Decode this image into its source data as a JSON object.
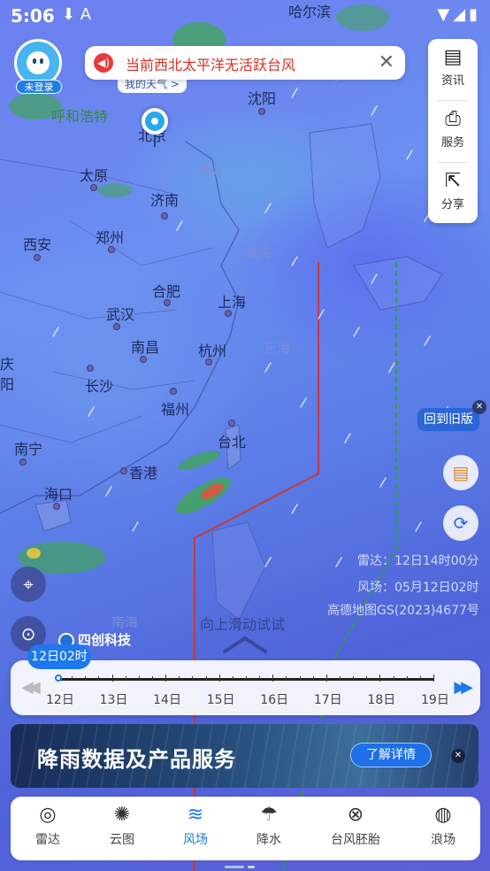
{
  "status_bar": {
    "time": "5:06",
    "left_icons": "⬇ A",
    "right_icons": "▼◢▮"
  },
  "user": {
    "login_badge": "未登录"
  },
  "notice": {
    "text": "当前西北太平洋无活跃台风"
  },
  "location": {
    "weather_tag": "我的天气 >"
  },
  "side_menu": [
    {
      "label": "资讯",
      "icon": "news-icon",
      "glyph": "▤"
    },
    {
      "label": "服务",
      "icon": "service-icon",
      "glyph": "⎙"
    },
    {
      "label": "分享",
      "icon": "share-icon",
      "glyph": "⇱"
    }
  ],
  "map": {
    "cities": [
      {
        "name": "哈尔滨",
        "class": ""
      },
      {
        "name": "呼和浩特",
        "class": "green"
      },
      {
        "name": "北京",
        "class": ""
      },
      {
        "name": "沈阳",
        "class": ""
      },
      {
        "name": "太原",
        "class": ""
      },
      {
        "name": "济南",
        "class": ""
      },
      {
        "name": "渤海",
        "class": "sea"
      },
      {
        "name": "西安",
        "class": ""
      },
      {
        "name": "郑州",
        "class": ""
      },
      {
        "name": "黄海",
        "class": "sea"
      },
      {
        "name": "合肥",
        "class": ""
      },
      {
        "name": "上海",
        "class": ""
      },
      {
        "name": "武汉",
        "class": ""
      },
      {
        "name": "南昌",
        "class": ""
      },
      {
        "name": "杭州",
        "class": ""
      },
      {
        "name": "东海",
        "class": "sea"
      },
      {
        "name": "长沙",
        "class": ""
      },
      {
        "name": "福州",
        "class": ""
      },
      {
        "name": "台北",
        "class": ""
      },
      {
        "name": "南宁",
        "class": ""
      },
      {
        "name": "香港",
        "class": ""
      },
      {
        "name": "海口",
        "class": ""
      },
      {
        "name": "南海",
        "class": "sea"
      },
      {
        "name": "庆",
        "class": ""
      },
      {
        "name": "阳",
        "class": ""
      }
    ],
    "old_version_label": "回到旧版",
    "radar_time": "雷达：12日14时00分",
    "wind_time": "风场：05月12日02时",
    "map_license": "高德地图GS(2023)4677号",
    "slide_hint": "向上滑动试试",
    "brand": "四创科技"
  },
  "timeline": {
    "current_label": "12日02时",
    "days": [
      "12日",
      "13日",
      "14日",
      "15日",
      "16日",
      "17日",
      "18日",
      "19日"
    ],
    "progress": 0
  },
  "banner": {
    "title": "降雨数据及产品服务",
    "cta": "了解详情"
  },
  "tabs": [
    {
      "label": "雷达",
      "icon": "radar-icon",
      "glyph": "◎",
      "active": false
    },
    {
      "label": "云图",
      "icon": "satellite-icon",
      "glyph": "✺",
      "active": false
    },
    {
      "label": "风场",
      "icon": "wind-icon",
      "glyph": "≋",
      "active": true
    },
    {
      "label": "降水",
      "icon": "rain-cloud-icon",
      "glyph": "☂",
      "active": false
    },
    {
      "label": "台风胚胎",
      "icon": "typhoon-embryo-icon",
      "glyph": "⊗",
      "active": false
    },
    {
      "label": "浪场",
      "icon": "wave-icon",
      "glyph": "◍",
      "active": false
    }
  ],
  "colors": {
    "accent": "#1e78ee",
    "alert": "#d93025",
    "map_base": "#5a6fe0"
  }
}
